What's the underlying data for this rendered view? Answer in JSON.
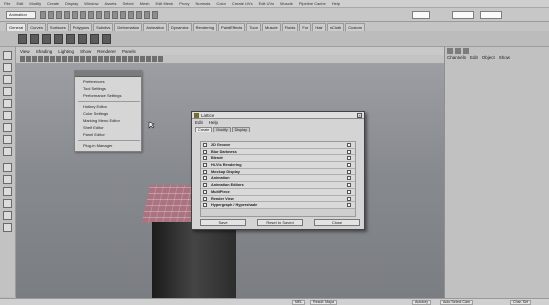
{
  "menubar": {
    "items": [
      "File",
      "Edit",
      "Modify",
      "Create",
      "Display",
      "Window",
      "Assets",
      "Select",
      "Mesh",
      "Edit Mesh",
      "Proxy",
      "Normals",
      "Color",
      "Create UVs",
      "Edit UVs",
      "Muscle",
      "Pipeline Cache",
      "Help"
    ]
  },
  "statusline": {
    "mode": "Animation"
  },
  "shelf_tabs": {
    "items": [
      "General",
      "Curves",
      "Surfaces",
      "Polygons",
      "Subdivs",
      "Deformation",
      "Animation",
      "Dynamics",
      "Rendering",
      "PaintEffects",
      "Toon",
      "Muscle",
      "Fluids",
      "Fur",
      "Hair",
      "nCloth",
      "Custom"
    ],
    "active_index": 0
  },
  "panel_menu": {
    "items": [
      "View",
      "Shading",
      "Lighting",
      "Show",
      "Renderer",
      "Panels"
    ]
  },
  "channel_box": {
    "tabs": [
      "Channels",
      "Edit",
      "Object",
      "Show"
    ]
  },
  "popup_menu": {
    "items": [
      "Preferences",
      "Tool Settings",
      "Performance Settings",
      "Hotkey Editor",
      "Color Settings",
      "Marking Menu Editor",
      "Shelf Editor",
      "Panel Editor",
      "Plug-in Manager"
    ]
  },
  "dialog": {
    "title": "Lattice",
    "menu": [
      "Edit",
      "Help"
    ],
    "tabs": [
      "Create",
      "Modify",
      "Display"
    ],
    "items": [
      "2D Groove",
      "Blur Darkness",
      "Blendr",
      "Hi-Vis Rendering",
      "Mockup Display",
      "Animation",
      "Animation Editors",
      "MultiPiece",
      "Render View",
      "Hypergraph / Hypershade"
    ],
    "buttons": [
      "Save",
      "Reset to Saved",
      "Close"
    ]
  },
  "bottom_bar": {
    "items": [
      "MEL",
      "Result: Maya",
      "Autokey",
      "Auto Select Cam",
      "Char. Set"
    ]
  },
  "colors": {
    "viewport_top": "#9c9ea3",
    "viewport_bottom": "#7a7d82",
    "object_top": "#b07a86",
    "object_body": "#2a2a2a",
    "ui_gray": "#c4c4c4"
  }
}
